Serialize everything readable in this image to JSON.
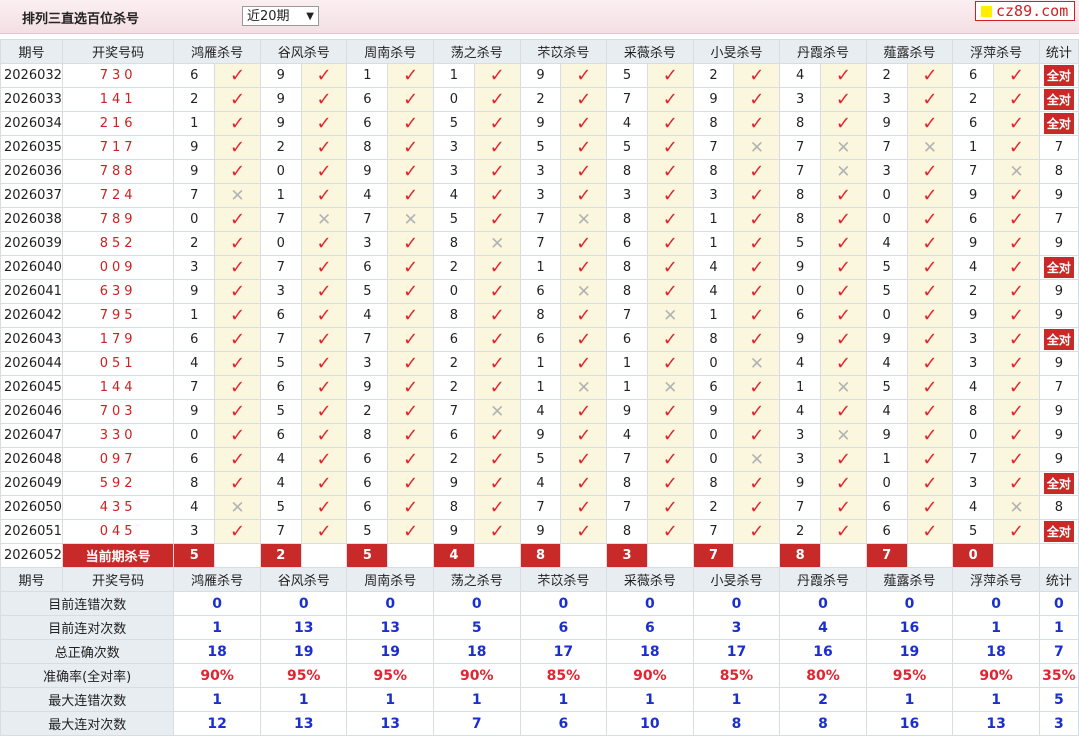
{
  "header": {
    "title": "排列三直选百位杀号",
    "period_select": "近20期",
    "logo": "cz89.com"
  },
  "columns": {
    "period": "期号",
    "open": "开奖号码",
    "experts": [
      "鸿雁杀号",
      "谷风杀号",
      "周南杀号",
      "荡之杀号",
      "芣苡杀号",
      "采薇杀号",
      "小旻杀号",
      "丹霞杀号",
      "薤露杀号",
      "浮萍杀号"
    ],
    "stat": "统计"
  },
  "rows": [
    {
      "period": "2026032",
      "open": "730",
      "kills": [
        6,
        9,
        1,
        1,
        9,
        5,
        2,
        4,
        2,
        6
      ],
      "marks": [
        "ok",
        "ok",
        "ok",
        "ok",
        "ok",
        "ok",
        "ok",
        "ok",
        "ok",
        "ok"
      ],
      "stat": "全对"
    },
    {
      "period": "2026033",
      "open": "141",
      "kills": [
        2,
        9,
        6,
        0,
        2,
        7,
        9,
        3,
        3,
        2
      ],
      "marks": [
        "ok",
        "ok",
        "ok",
        "ok",
        "ok",
        "ok",
        "ok",
        "ok",
        "ok",
        "ok"
      ],
      "stat": "全对"
    },
    {
      "period": "2026034",
      "open": "216",
      "kills": [
        1,
        9,
        6,
        5,
        9,
        4,
        8,
        8,
        9,
        6
      ],
      "marks": [
        "ok",
        "ok",
        "ok",
        "ok",
        "ok",
        "ok",
        "ok",
        "ok",
        "ok",
        "ok"
      ],
      "stat": "全对"
    },
    {
      "period": "2026035",
      "open": "717",
      "kills": [
        9,
        2,
        8,
        3,
        5,
        5,
        7,
        7,
        7,
        1
      ],
      "marks": [
        "ok",
        "ok",
        "ok",
        "ok",
        "ok",
        "ok",
        "bad",
        "bad",
        "bad",
        "ok"
      ],
      "stat": "7"
    },
    {
      "period": "2026036",
      "open": "788",
      "kills": [
        9,
        0,
        9,
        3,
        3,
        8,
        8,
        7,
        3,
        7
      ],
      "marks": [
        "ok",
        "ok",
        "ok",
        "ok",
        "ok",
        "ok",
        "ok",
        "bad",
        "ok",
        "bad"
      ],
      "stat": "8"
    },
    {
      "period": "2026037",
      "open": "724",
      "kills": [
        7,
        1,
        4,
        4,
        3,
        3,
        3,
        8,
        0,
        9
      ],
      "marks": [
        "bad",
        "ok",
        "ok",
        "ok",
        "ok",
        "ok",
        "ok",
        "ok",
        "ok",
        "ok"
      ],
      "stat": "9"
    },
    {
      "period": "2026038",
      "open": "789",
      "kills": [
        0,
        7,
        7,
        5,
        7,
        8,
        1,
        8,
        0,
        6
      ],
      "marks": [
        "ok",
        "bad",
        "bad",
        "ok",
        "bad",
        "ok",
        "ok",
        "ok",
        "ok",
        "ok"
      ],
      "stat": "7"
    },
    {
      "period": "2026039",
      "open": "852",
      "kills": [
        2,
        0,
        3,
        8,
        7,
        6,
        1,
        5,
        4,
        9
      ],
      "marks": [
        "ok",
        "ok",
        "ok",
        "bad",
        "ok",
        "ok",
        "ok",
        "ok",
        "ok",
        "ok"
      ],
      "stat": "9"
    },
    {
      "period": "2026040",
      "open": "009",
      "kills": [
        3,
        7,
        6,
        2,
        1,
        8,
        4,
        9,
        5,
        4
      ],
      "marks": [
        "ok",
        "ok",
        "ok",
        "ok",
        "ok",
        "ok",
        "ok",
        "ok",
        "ok",
        "ok"
      ],
      "stat": "全对"
    },
    {
      "period": "2026041",
      "open": "639",
      "kills": [
        9,
        3,
        5,
        0,
        6,
        8,
        4,
        0,
        5,
        2
      ],
      "marks": [
        "ok",
        "ok",
        "ok",
        "ok",
        "bad",
        "ok",
        "ok",
        "ok",
        "ok",
        "ok"
      ],
      "stat": "9"
    },
    {
      "period": "2026042",
      "open": "795",
      "kills": [
        1,
        6,
        4,
        8,
        8,
        7,
        1,
        6,
        0,
        9
      ],
      "marks": [
        "ok",
        "ok",
        "ok",
        "ok",
        "ok",
        "bad",
        "ok",
        "ok",
        "ok",
        "ok"
      ],
      "stat": "9"
    },
    {
      "period": "2026043",
      "open": "179",
      "kills": [
        6,
        7,
        7,
        6,
        6,
        6,
        8,
        9,
        9,
        3
      ],
      "marks": [
        "ok",
        "ok",
        "ok",
        "ok",
        "ok",
        "ok",
        "ok",
        "ok",
        "ok",
        "ok"
      ],
      "stat": "全对"
    },
    {
      "period": "2026044",
      "open": "051",
      "kills": [
        4,
        5,
        3,
        2,
        1,
        1,
        0,
        4,
        4,
        3
      ],
      "marks": [
        "ok",
        "ok",
        "ok",
        "ok",
        "ok",
        "ok",
        "bad",
        "ok",
        "ok",
        "ok"
      ],
      "stat": "9"
    },
    {
      "period": "2026045",
      "open": "144",
      "kills": [
        7,
        6,
        9,
        2,
        1,
        1,
        6,
        1,
        5,
        4
      ],
      "marks": [
        "ok",
        "ok",
        "ok",
        "ok",
        "bad",
        "bad",
        "ok",
        "bad",
        "ok",
        "ok"
      ],
      "stat": "7"
    },
    {
      "period": "2026046",
      "open": "703",
      "kills": [
        9,
        5,
        2,
        7,
        4,
        9,
        9,
        4,
        4,
        8
      ],
      "marks": [
        "ok",
        "ok",
        "ok",
        "bad",
        "ok",
        "ok",
        "ok",
        "ok",
        "ok",
        "ok"
      ],
      "stat": "9"
    },
    {
      "period": "2026047",
      "open": "330",
      "kills": [
        0,
        6,
        8,
        6,
        9,
        4,
        0,
        3,
        9,
        0
      ],
      "marks": [
        "ok",
        "ok",
        "ok",
        "ok",
        "ok",
        "ok",
        "ok",
        "bad",
        "ok",
        "ok"
      ],
      "stat": "9"
    },
    {
      "period": "2026048",
      "open": "097",
      "kills": [
        6,
        4,
        6,
        2,
        5,
        7,
        0,
        3,
        1,
        7
      ],
      "marks": [
        "ok",
        "ok",
        "ok",
        "ok",
        "ok",
        "ok",
        "bad",
        "ok",
        "ok",
        "ok"
      ],
      "stat": "9"
    },
    {
      "period": "2026049",
      "open": "592",
      "kills": [
        8,
        4,
        6,
        9,
        4,
        8,
        8,
        9,
        0,
        3
      ],
      "marks": [
        "ok",
        "ok",
        "ok",
        "ok",
        "ok",
        "ok",
        "ok",
        "ok",
        "ok",
        "ok"
      ],
      "stat": "全对"
    },
    {
      "period": "2026050",
      "open": "435",
      "kills": [
        4,
        5,
        6,
        8,
        7,
        7,
        2,
        7,
        6,
        4
      ],
      "marks": [
        "bad",
        "ok",
        "ok",
        "ok",
        "ok",
        "ok",
        "ok",
        "ok",
        "ok",
        "bad"
      ],
      "stat": "8"
    },
    {
      "period": "2026051",
      "open": "045",
      "kills": [
        3,
        7,
        5,
        9,
        9,
        8,
        7,
        2,
        6,
        5
      ],
      "marks": [
        "ok",
        "ok",
        "ok",
        "ok",
        "ok",
        "ok",
        "ok",
        "ok",
        "ok",
        "ok"
      ],
      "stat": "全对"
    }
  ],
  "current": {
    "period": "2026052",
    "label": "当前期杀号",
    "kills": [
      "5",
      "2",
      "5",
      "4",
      "8",
      "3",
      "7",
      "8",
      "7",
      "0"
    ]
  },
  "stats": [
    {
      "label": "目前连错次数",
      "values": [
        "0",
        "0",
        "0",
        "0",
        "0",
        "0",
        "0",
        "0",
        "0",
        "0",
        "0"
      ],
      "pct": false
    },
    {
      "label": "目前连对次数",
      "values": [
        "1",
        "13",
        "13",
        "5",
        "6",
        "6",
        "3",
        "4",
        "16",
        "1",
        "1"
      ],
      "pct": false
    },
    {
      "label": "总正确次数",
      "values": [
        "18",
        "19",
        "19",
        "18",
        "17",
        "18",
        "17",
        "16",
        "19",
        "18",
        "7"
      ],
      "pct": false
    },
    {
      "label": "准确率(全对率)",
      "values": [
        "90%",
        "95%",
        "95%",
        "90%",
        "85%",
        "90%",
        "85%",
        "80%",
        "95%",
        "90%",
        "35%"
      ],
      "pct": true
    },
    {
      "label": "最大连错次数",
      "values": [
        "1",
        "1",
        "1",
        "1",
        "1",
        "1",
        "1",
        "2",
        "1",
        "1",
        "5"
      ],
      "pct": false
    },
    {
      "label": "最大连对次数",
      "values": [
        "12",
        "13",
        "13",
        "7",
        "6",
        "10",
        "8",
        "8",
        "16",
        "13",
        "3"
      ],
      "pct": false
    }
  ],
  "icons": {
    "ok": "check-icon",
    "bad": "cross-icon"
  },
  "colors": {
    "accent": "#c82a2a",
    "check": "#e2242f",
    "stat_blue": "#1a2fd0",
    "header_bg": "#e8edf2",
    "mark_bg": "#fbf7df"
  }
}
